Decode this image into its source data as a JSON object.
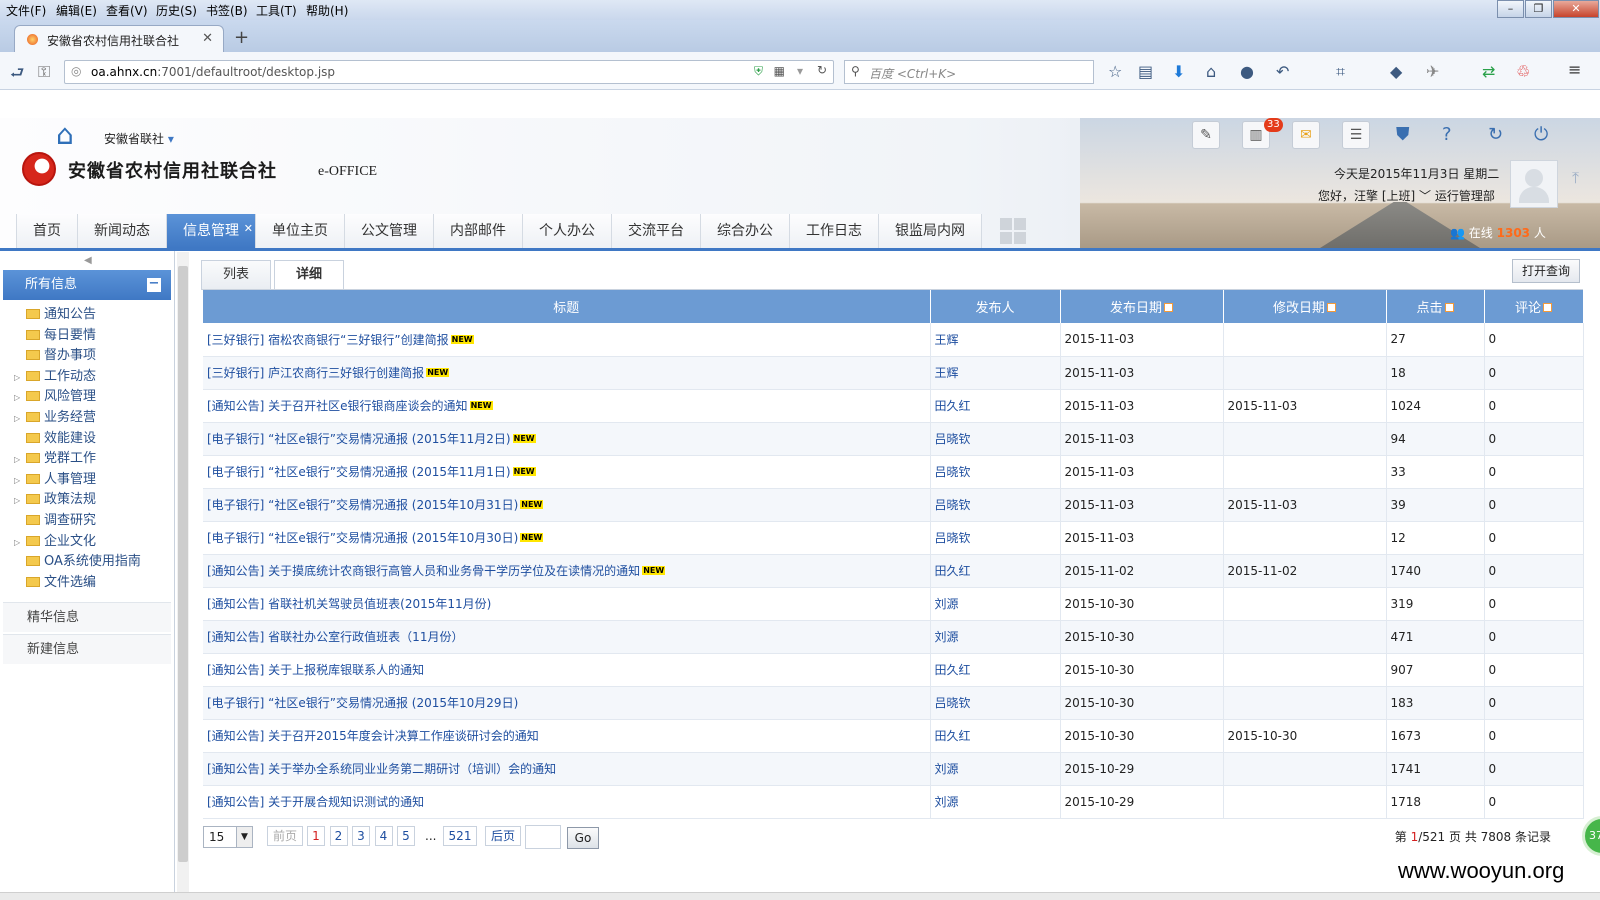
{
  "browser": {
    "menu": [
      "文件(F)",
      "编辑(E)",
      "查看(V)",
      "历史(S)",
      "书签(B)",
      "工具(T)",
      "帮助(H)"
    ],
    "tab_title": "安徽省农村信用社联合社",
    "url_host": "oa.ahnx.cn",
    "url_rest": ":7001/defaultroot/desktop.jsp",
    "search_placeholder": "百度 <Ctrl+K>"
  },
  "header": {
    "org_select": "安徽省联社",
    "logo_text": "安徽省农村信用社联合社",
    "logo_sub": "e-OFFICE",
    "notification_count": "33",
    "date": "今天是2015年11月3日 星期二",
    "greeting": "您好，汪擎 [上班]",
    "role": "运行管理部",
    "online_prefix": "在线",
    "online_count": "1303",
    "online_suffix": "人"
  },
  "nav": [
    "首页",
    "新闻动态",
    "信息管理",
    "单位主页",
    "公文管理",
    "内部邮件",
    "个人办公",
    "交流平台",
    "综合办公",
    "工作日志",
    "银监局内网"
  ],
  "nav_active": "信息管理",
  "sidebar": {
    "title": "所有信息",
    "items": [
      {
        "label": "通知公告",
        "expandable": false
      },
      {
        "label": "每日要情",
        "expandable": false
      },
      {
        "label": "督办事项",
        "expandable": false
      },
      {
        "label": "工作动态",
        "expandable": true
      },
      {
        "label": "风险管理",
        "expandable": true
      },
      {
        "label": "业务经营",
        "expandable": true
      },
      {
        "label": "效能建设",
        "expandable": false
      },
      {
        "label": "党群工作",
        "expandable": true
      },
      {
        "label": "人事管理",
        "expandable": true
      },
      {
        "label": "政策法规",
        "expandable": true
      },
      {
        "label": "调查研究",
        "expandable": false
      },
      {
        "label": "企业文化",
        "expandable": true
      },
      {
        "label": "OA系统使用指南",
        "expandable": false
      },
      {
        "label": "文件选编",
        "expandable": false
      }
    ],
    "groups": [
      "精华信息",
      "新建信息"
    ]
  },
  "content": {
    "tabs": [
      "列表",
      "详细"
    ],
    "active_tab": "详细",
    "open_query": "打开查询",
    "new_badge": "NEW",
    "columns": [
      "标题",
      "发布人",
      "发布日期",
      "修改日期",
      "点击",
      "评论"
    ],
    "rows": [
      {
        "title": "[三好银行] 宿松农商银行“三好银行”创建简报",
        "new": true,
        "author": "王辉",
        "published": "2015-11-03",
        "modified": "",
        "clicks": "27",
        "comments": "0"
      },
      {
        "title": "[三好银行] 庐江农商行三好银行创建简报",
        "new": true,
        "author": "王辉",
        "published": "2015-11-03",
        "modified": "",
        "clicks": "18",
        "comments": "0"
      },
      {
        "title": "[通知公告] 关于召开社区e银行银商座谈会的通知",
        "new": true,
        "author": "田久红",
        "published": "2015-11-03",
        "modified": "2015-11-03",
        "clicks": "1024",
        "comments": "0"
      },
      {
        "title": "[电子银行] “社区e银行”交易情况通报 (2015年11月2日)",
        "new": true,
        "author": "吕晓钦",
        "published": "2015-11-03",
        "modified": "",
        "clicks": "94",
        "comments": "0"
      },
      {
        "title": "[电子银行] “社区e银行”交易情况通报 (2015年11月1日)",
        "new": true,
        "author": "吕晓钦",
        "published": "2015-11-03",
        "modified": "",
        "clicks": "33",
        "comments": "0"
      },
      {
        "title": "[电子银行] “社区e银行”交易情况通报 (2015年10月31日)",
        "new": true,
        "author": "吕晓钦",
        "published": "2015-11-03",
        "modified": "2015-11-03",
        "clicks": "39",
        "comments": "0"
      },
      {
        "title": "[电子银行] “社区e银行”交易情况通报 (2015年10月30日)",
        "new": true,
        "author": "吕晓钦",
        "published": "2015-11-03",
        "modified": "",
        "clicks": "12",
        "comments": "0"
      },
      {
        "title": "[通知公告] 关于摸底统计农商银行高管人员和业务骨干学历学位及在读情况的通知",
        "new": true,
        "author": "田久红",
        "published": "2015-11-02",
        "modified": "2015-11-02",
        "clicks": "1740",
        "comments": "0"
      },
      {
        "title": "[通知公告] 省联社机关驾驶员值班表(2015年11月份)",
        "new": false,
        "author": "刘源",
        "published": "2015-10-30",
        "modified": "",
        "clicks": "319",
        "comments": "0"
      },
      {
        "title": "[通知公告] 省联社办公室行政值班表（11月份）",
        "new": false,
        "author": "刘源",
        "published": "2015-10-30",
        "modified": "",
        "clicks": "471",
        "comments": "0"
      },
      {
        "title": "[通知公告] 关于上报税库银联系人的通知",
        "new": false,
        "author": "田久红",
        "published": "2015-10-30",
        "modified": "",
        "clicks": "907",
        "comments": "0"
      },
      {
        "title": "[电子银行] “社区e银行”交易情况通报 (2015年10月29日)",
        "new": false,
        "author": "吕晓钦",
        "published": "2015-10-30",
        "modified": "",
        "clicks": "183",
        "comments": "0"
      },
      {
        "title": "[通知公告] 关于召开2015年度会计决算工作座谈研讨会的通知",
        "new": false,
        "author": "田久红",
        "published": "2015-10-30",
        "modified": "2015-10-30",
        "clicks": "1673",
        "comments": "0"
      },
      {
        "title": "[通知公告] 关于举办全系统同业业务第二期研讨（培训）会的通知",
        "new": false,
        "author": "刘源",
        "published": "2015-10-29",
        "modified": "",
        "clicks": "1741",
        "comments": "0"
      },
      {
        "title": "[通知公告] 关于开展合规知识测试的通知",
        "new": false,
        "author": "刘源",
        "published": "2015-10-29",
        "modified": "",
        "clicks": "1718",
        "comments": "0"
      }
    ]
  },
  "pager": {
    "page_size": "15",
    "prev": "前页",
    "pages": [
      "1",
      "2",
      "3",
      "4",
      "5"
    ],
    "ellipsis": "...",
    "last": "521",
    "next": "后页",
    "go": "Go",
    "info_prefix": "第",
    "current": "1",
    "info_mid": "/521 页",
    "info_total": "共 7808 条记录"
  },
  "floating_badge": "37",
  "watermark": "www.wooyun.org"
}
